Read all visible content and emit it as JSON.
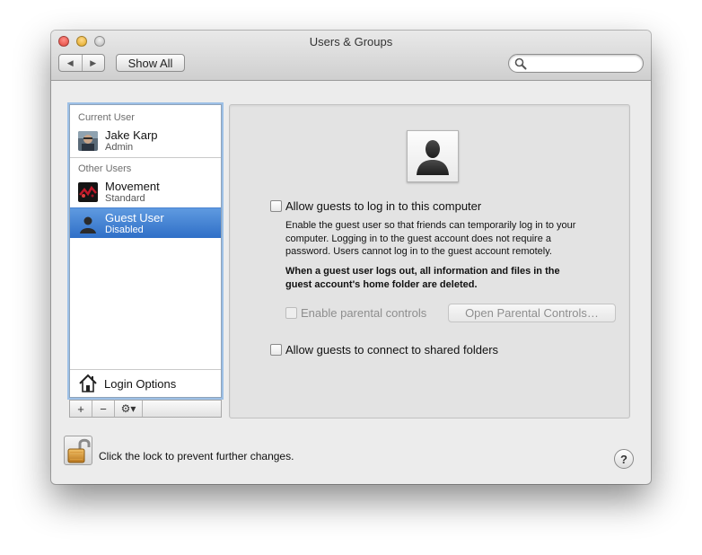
{
  "window": {
    "title": "Users & Groups"
  },
  "toolbar": {
    "back_icon": "back-arrow-icon",
    "forward_icon": "forward-arrow-icon",
    "show_all_label": "Show All",
    "search_placeholder": ""
  },
  "sidebar": {
    "current_user_header": "Current User",
    "other_users_header": "Other Users",
    "users": [
      {
        "name": "Jake Karp",
        "role": "Admin",
        "avatar": "user-photo-avatar"
      },
      {
        "name": "Movement",
        "role": "Standard",
        "avatar": "red-abstract-avatar"
      },
      {
        "name": "Guest User",
        "role": "Disabled",
        "avatar": "guest-silhouette-avatar",
        "selected": true
      }
    ],
    "login_options_label": "Login Options",
    "tools": {
      "add": "+",
      "remove": "−",
      "action": "⚙▾"
    }
  },
  "panel": {
    "allow_guests_login_label": "Allow guests to log in to this computer",
    "allow_guests_login_checked": false,
    "description": [
      "Enable the guest user so that friends can temporarily log in to your",
      "computer. Logging in to the guest account does not require a",
      "password. Users cannot log in to the guest account remotely."
    ],
    "warning": [
      "When a guest user logs out, all information and files in the",
      "guest account's home folder are deleted."
    ],
    "parental_controls_label": "Enable parental controls",
    "open_parental_controls_label": "Open Parental Controls…",
    "allow_shared_folders_label": "Allow guests to connect to shared folders",
    "allow_shared_folders_checked": false
  },
  "footer": {
    "lock_text": "Click the lock to prevent further changes.",
    "help_label": "?"
  },
  "colors": {
    "selection": "#3b7bd0",
    "focus_ring": "#9dc0e6",
    "window_bg": "#ececec"
  }
}
